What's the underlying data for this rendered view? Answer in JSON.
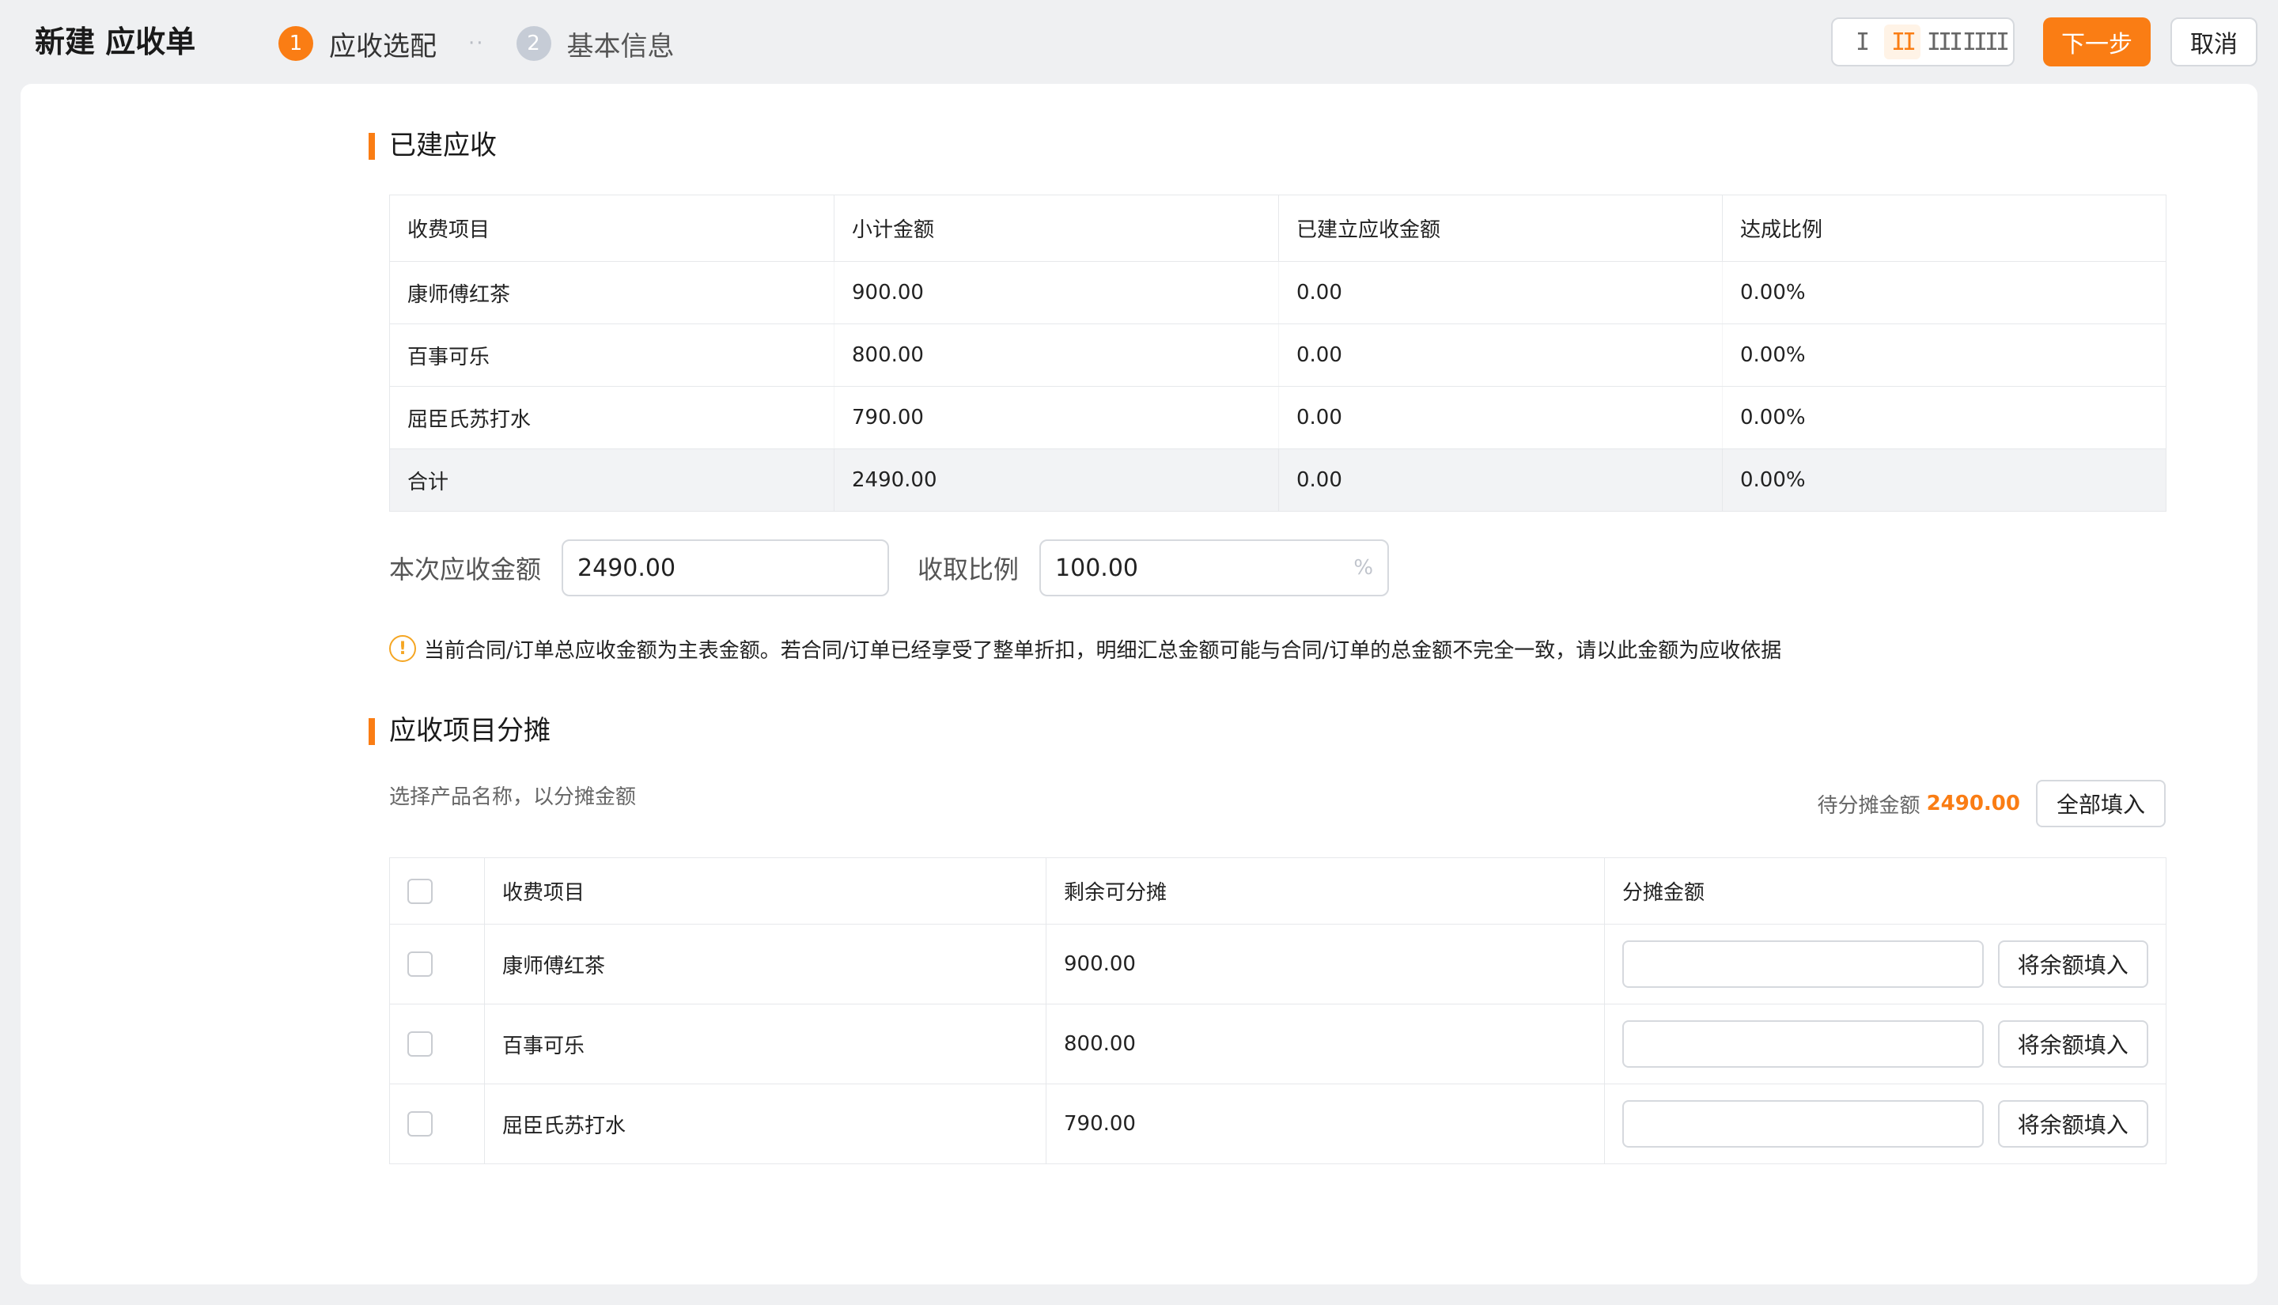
{
  "header": {
    "title": "新建 应收单",
    "steps": [
      {
        "num": "1",
        "label": "应收选配"
      },
      {
        "num": "2",
        "label": "基本信息"
      }
    ],
    "step_separator": "··",
    "density_options": [
      "I",
      "II",
      "III",
      "IIII"
    ],
    "density_selected": "II",
    "next_label": "下一步",
    "cancel_label": "取消"
  },
  "created": {
    "title": "已建应收",
    "columns": [
      "收费项目",
      "小计金额",
      "已建立应收金额",
      "达成比例"
    ],
    "rows": [
      [
        "康师傅红茶",
        "900.00",
        "0.00",
        "0.00%"
      ],
      [
        "百事可乐",
        "800.00",
        "0.00",
        "0.00%"
      ],
      [
        "屈臣氏苏打水",
        "790.00",
        "0.00",
        "0.00%"
      ]
    ],
    "total": [
      "合计",
      "2490.00",
      "0.00",
      "0.00%"
    ]
  },
  "form": {
    "amount_label": "本次应收金额",
    "amount_value": "2490.00",
    "ratio_label": "收取比例",
    "ratio_value": "100.00",
    "ratio_suffix": "%"
  },
  "notice": {
    "icon": "warning-circle-icon",
    "text": "当前合同/订单总应收金额为主表金额。若合同/订单已经享受了整单折扣，明细汇总金额可能与合同/订单的总金额不完全一致，请以此金额为应收依据"
  },
  "allocation": {
    "title": "应收项目分摊",
    "hint": "选择产品名称，以分摊金额",
    "pending_label": "待分摊金额",
    "pending_value": "2490.00",
    "fill_all_label": "全部填入",
    "columns": [
      "收费项目",
      "剩余可分摊",
      "分摊金额"
    ],
    "rows": [
      {
        "item": "康师傅红茶",
        "remaining": "900.00",
        "amount": ""
      },
      {
        "item": "百事可乐",
        "remaining": "800.00",
        "amount": ""
      },
      {
        "item": "屈臣氏苏打水",
        "remaining": "790.00",
        "amount": ""
      }
    ],
    "fill_remaining_label": "将余额填入"
  },
  "colors": {
    "accent": "#fa7d14",
    "background": "#eff0f2",
    "warning": "#f5a623"
  }
}
